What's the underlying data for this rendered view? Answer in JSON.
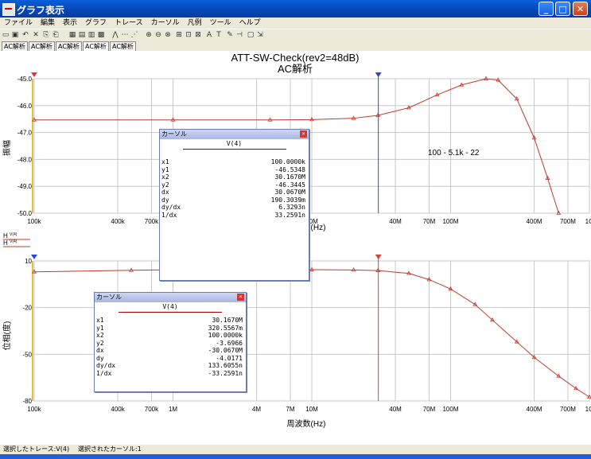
{
  "window": {
    "title": "グラフ表示"
  },
  "menu": [
    "ファイル",
    "編集",
    "表示",
    "グラフ",
    "トレース",
    "カーソル",
    "凡例",
    "ツール",
    "ヘルプ"
  ],
  "tabs": [
    "AC解析",
    "AC解析",
    "AC解析",
    "AC解析",
    "AC解析"
  ],
  "toolbar_icons": [
    "open-icon",
    "save-icon",
    "undo-icon",
    "delete-icon",
    "copy-icon",
    "paste-icon",
    "grid-icon",
    "grid2-icon",
    "grid3-icon",
    "print-icon",
    "trace-icon",
    "trace2-icon",
    "trace3-icon",
    "zoom-in-icon",
    "zoom-out-icon",
    "zoom-fit-icon",
    "zoom-area-icon",
    "zoom-x-icon",
    "zoom-y-icon",
    "font-icon",
    "text-icon",
    "marker-icon",
    "cursor-icon",
    "copy-graph-icon",
    "export-icon"
  ],
  "toolbar_glyphs": [
    "▭",
    "▣",
    "↶",
    "✕",
    "⎘",
    "⎗",
    "▦",
    "▤",
    "▥",
    "▩",
    "⋀",
    "⋯",
    "⋰",
    "⊕",
    "⊖",
    "⊗",
    "⊞",
    "⊡",
    "⊠",
    "A",
    "T",
    "✎",
    "⊣",
    "▢",
    "⇲"
  ],
  "colors": {
    "trace": "#c0392b",
    "cursor_blue": "#3344cc",
    "cursor_red": "#d04040",
    "grid": "#c8c8c8",
    "tick_marker": "#e0c040"
  },
  "chart": {
    "title": "ATT-SW-Check(rev2=48dB)",
    "subtitle": "AC解析",
    "annotation": "100 - 5.1k - 22",
    "xlabel": "周波数(Hz)"
  },
  "chart_data": [
    {
      "type": "line",
      "name": "magnitude",
      "ylabel": "振幅",
      "ylim": [
        -50.0,
        -45.0
      ],
      "yticks": [
        "-45.0",
        "-46.0",
        "-47.0",
        "-48.0",
        "-49.0",
        "-50.0"
      ],
      "xscale": "log",
      "xlim": [
        100000,
        1000000000
      ],
      "xticks": [
        "100k",
        "400k",
        "700k",
        "1M",
        "4M",
        "7M",
        "10M",
        "40M",
        "70M",
        "100M",
        "400M",
        "700M",
        "1G"
      ],
      "trace_label": "V(4)",
      "legend_icon": "H",
      "x": [
        100000,
        1000000,
        5000000,
        10000000,
        20000000,
        30000000,
        50000000,
        80000000,
        120000000,
        180000000,
        220000000,
        300000000,
        400000000,
        500000000,
        600000000
      ],
      "y": [
        -46.53,
        -46.53,
        -46.53,
        -46.52,
        -46.47,
        -46.36,
        -46.08,
        -45.6,
        -45.23,
        -45.0,
        -45.05,
        -45.75,
        -47.2,
        -48.7,
        -50.0
      ]
    },
    {
      "type": "line",
      "name": "phase",
      "ylabel": "位相(度)",
      "ylim": [
        -80,
        10
      ],
      "yticks": [
        "10",
        "-20",
        "-50",
        "-80"
      ],
      "xscale": "log",
      "xlim": [
        100000,
        1000000000
      ],
      "xticks": [
        "100k",
        "400k",
        "700k",
        "1M",
        "4M",
        "7M",
        "10M",
        "40M",
        "70M",
        "100M",
        "400M",
        "700M",
        "1G"
      ],
      "trace_label": "V(4)",
      "legend_icon": "H",
      "x": [
        100000,
        500000,
        1000000,
        5000000,
        10000000,
        20000000,
        30000000,
        50000000,
        70000000,
        100000000,
        150000000,
        200000000,
        300000000,
        400000000,
        600000000,
        800000000,
        1000000000
      ],
      "y": [
        3.0,
        4.0,
        4.3,
        4.4,
        4.4,
        4.2,
        3.8,
        2.0,
        -2.0,
        -8.0,
        -18.0,
        -28.0,
        -42.0,
        -52.0,
        -64.0,
        -72.0,
        -77.5
      ]
    }
  ],
  "cursors": {
    "mag": {
      "x1": 100000,
      "x2": 30167000
    },
    "phase": {
      "x1": 30167000,
      "x2": 100000
    }
  },
  "cursor_window_mag": {
    "title": "カーソル",
    "trace": "V(4)",
    "rows": [
      {
        "k": "x1",
        "v": "100.0000k"
      },
      {
        "k": "y1",
        "v": "-46.5348"
      },
      {
        "k": "x2",
        "v": "30.1670M"
      },
      {
        "k": "y2",
        "v": "-46.3445"
      },
      {
        "k": "dx",
        "v": "30.0670M"
      },
      {
        "k": "dy",
        "v": "190.3039m"
      },
      {
        "k": "dy/dx",
        "v": "6.3293n"
      },
      {
        "k": "1/dx",
        "v": "33.2591n"
      }
    ]
  },
  "cursor_window_phase": {
    "title": "カーソル",
    "trace": "V(4)",
    "rows": [
      {
        "k": "x1",
        "v": "30.1670M"
      },
      {
        "k": "y1",
        "v": "320.5567m"
      },
      {
        "k": "x2",
        "v": "100.0000k"
      },
      {
        "k": "y2",
        "v": "-3.6966"
      },
      {
        "k": "dx",
        "v": "-30.0670M"
      },
      {
        "k": "dy",
        "v": "-4.0171"
      },
      {
        "k": "dy/dx",
        "v": "133.6055n"
      },
      {
        "k": "1/dx",
        "v": "-33.2591n"
      }
    ]
  },
  "status": {
    "selected_trace": "選択したトレース:V(4)",
    "selected_cursor": "選択されたカーソル:1"
  }
}
